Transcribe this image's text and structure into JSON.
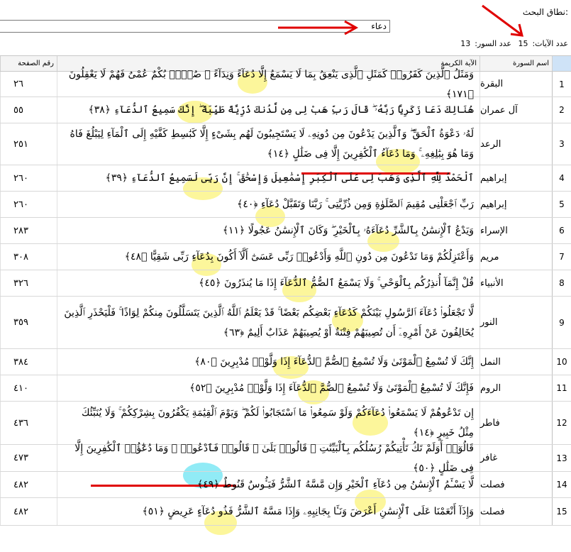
{
  "search": {
    "label": "نطاق البحث:",
    "value": "دعاء"
  },
  "counts": {
    "ayat_label": "عدد الآيات:",
    "ayat": "15",
    "suwar_label": "عدد السور:",
    "suwar": "13"
  },
  "columns": {
    "page": "رقم الصفحة",
    "verse": "الآية الكريمة",
    "surah": "اسم السورة"
  },
  "rows": [
    {
      "n": "1",
      "surah": "البقرة",
      "page": "٢٦",
      "verse": "وَمَثَلُ ٱلَّذِينَ كَفَرُوا۟ كَمَثَلِ ٱلَّذِى يَنْعِقُ بِمَا لَا يَسْمَعُ إِلَّا دُعَآءً وَنِدَآءً ۚ صُمٌّۢ بُكْمٌ عُمْىٌ فَهُمْ لَا يَعْقِلُونَ ﴿١٧١﴾"
    },
    {
      "n": "2",
      "surah": "آل عمران",
      "page": "٥٥",
      "verse": "هُنَالِكَ دَعَا زَكَرِيَّا رَبَّهُۥ ۖ قَالَ رَبِّ هَبْ لِى مِن لَّدُنكَ ذُرِّيَّةً طَيِّبَةً ۖ إِنَّكَ سَمِيعُ ٱلدُّعَآءِ ﴿٣٨﴾"
    },
    {
      "n": "3",
      "surah": "الرعد",
      "page": "٢٥١",
      "verse": "لَهُۥ دَعْوَةُ ٱلْحَقِّ ۖ وَٱلَّذِينَ يَدْعُونَ مِن دُونِهِۦ لَا يَسْتَجِيبُونَ لَهُم بِشَىْءٍ إِلَّا كَبَٰسِطِ كَفَّيْهِ إِلَى ٱلْمَآءِ لِيَبْلُغَ فَاهُ وَمَا هُوَ بِبَٰلِغِهِۦ ۚ وَمَا دُعَآءُ ٱلْكَٰفِرِينَ إِلَّا فِى ضَلَٰلٍ ﴿١٤﴾"
    },
    {
      "n": "4",
      "surah": "إبراهيم",
      "page": "٢٦٠",
      "verse": "ٱلْحَمْدُ لِلَّهِ ٱلَّذِى وَهَبَ لِى عَلَى ٱلْكِبَرِ إِسْمَٰعِيلَ وَإِسْحَٰقَ ۚ إِنَّ رَبِّى لَسَمِيعُ ٱلدُّعَآءِ ﴿٣٩﴾"
    },
    {
      "n": "5",
      "surah": "إبراهيم",
      "page": "٢٦٠",
      "verse": "رَبِّ ٱجْعَلْنِى مُقِيمَ ٱلصَّلَوٰةِ وَمِن ذُرِّيَّتِى ۚ رَبَّنَا وَتَقَبَّلْ دُعَآءِ ﴿٤٠﴾"
    },
    {
      "n": "6",
      "surah": "الإسراء",
      "page": "٢٨٣",
      "verse": "وَيَدْعُ ٱلْإِنسَٰنُ بِٱلشَّرِّ دُعَآءَهُۥ بِٱلْخَيْرِ ۖ وَكَانَ ٱلْإِنسَٰنُ عَجُولًا ﴿١١﴾"
    },
    {
      "n": "7",
      "surah": "مريم",
      "page": "٣٠٨",
      "verse": "وَأَعْتَزِلُكُمْ وَمَا تَدْعُونَ مِن دُونِ ٱللَّهِ وَأَدْعُوا۟ رَبِّى عَسَىٰٓ أَلَّآ أَكُونَ بِدُعَآءِ رَبِّى شَقِيًّا ﴿٤٨﴾"
    },
    {
      "n": "8",
      "surah": "الأنبياء",
      "page": "٣٢٦",
      "verse": "قُلْ إِنَّمَآ أُنذِرُكُم بِٱلْوَحْىِ ۚ وَلَا يَسْمَعُ ٱلصُّمُّ ٱلدُّعَآءَ إِذَا مَا يُنذَرُونَ ﴿٤٥﴾"
    },
    {
      "n": "9",
      "surah": "النور",
      "page": "٣٥٩",
      "verse": "لَّا تَجْعَلُوا۟ دُعَآءَ ٱلرَّسُولِ بَيْنَكُمْ كَدُعَآءِ بَعْضِكُم بَعْضًا ۚ قَدْ يَعْلَمُ ٱللَّهُ ٱلَّذِينَ يَتَسَلَّلُونَ مِنكُمْ لِوَاذًا ۚ فَلْيَحْذَرِ ٱلَّذِينَ يُخَالِفُونَ عَنْ أَمْرِهِۦٓ أَن تُصِيبَهُمْ فِتْنَةٌ أَوْ يُصِيبَهُمْ عَذَابٌ أَلِيمٌ ﴿٦٣﴾"
    },
    {
      "n": "10",
      "surah": "النمل",
      "page": "٣٨٤",
      "verse": "إِنَّكَ لَا تُسْمِعُ ٱلْمَوْتَىٰ وَلَا تُسْمِعُ ٱلصُّمَّ ٱلدُّعَآءَ إِذَا وَلَّوْا۟ مُدْبِرِينَ ﴿٨٠﴾"
    },
    {
      "n": "11",
      "surah": "الروم",
      "page": "٤١٠",
      "verse": "فَإِنَّكَ لَا تُسْمِعُ ٱلْمَوْتَىٰ وَلَا تُسْمِعُ ٱلصُّمَّ ٱلدُّعَآءَ إِذَا وَلَّوْا۟ مُدْبِرِينَ ﴿٥٢﴾"
    },
    {
      "n": "12",
      "surah": "فاطر",
      "page": "٤٣٦",
      "verse": "إِن تَدْعُوهُمْ لَا يَسْمَعُوا۟ دُعَآءَكُمْ وَلَوْ سَمِعُوا۟ مَا ٱسْتَجَابُوا۟ لَكُمْ ۖ وَيَوْمَ ٱلْقِيَٰمَةِ يَكْفُرُونَ بِشِرْكِكُمْ ۚ وَلَا يُنَبِّئُكَ مِثْلُ خَبِيرٍ ﴿١٤﴾"
    },
    {
      "n": "13",
      "surah": "غافر",
      "page": "٤٧٣",
      "verse": "قَالُوٓا۟ أَوَلَمْ تَكُ تَأْتِيكُمْ رُسُلُكُم بِٱلْبَيِّنَٰتِ ۖ قَالُوا۟ بَلَىٰ ۚ قَالُوا۟ فَٱدْعُوا۟ ۗ وَمَا دُعَٰٓؤُا۟ ٱلْكَٰفِرِينَ إِلَّا فِى ضَلَٰلٍ ﴿٥٠﴾"
    },
    {
      "n": "14",
      "surah": "فصلت",
      "page": "٤٨٢",
      "verse": "لَّا يَسْـَٔمُ ٱلْإِنسَٰنُ مِن دُعَآءِ ٱلْخَيْرِ وَإِن مَّسَّهُ ٱلشَّرُّ فَيَـُٔوسٌ قَنُوطٌ ﴿٤٩﴾"
    },
    {
      "n": "15",
      "surah": "فصلت",
      "page": "٤٨٢",
      "verse": "وَإِذَآ أَنْعَمْنَا عَلَى ٱلْإِنسَٰنِ أَعْرَضَ وَنَـَٔا بِجَانِبِهِۦ وَإِذَا مَسَّهُ ٱلشَّرُّ فَذُو دُعَآءٍ عَرِيضٍ ﴿٥١﴾"
    }
  ],
  "colors": {
    "highlight": "#fbf58a",
    "highlight_alt": "#7ee8f5",
    "annotation": "#e00000"
  }
}
